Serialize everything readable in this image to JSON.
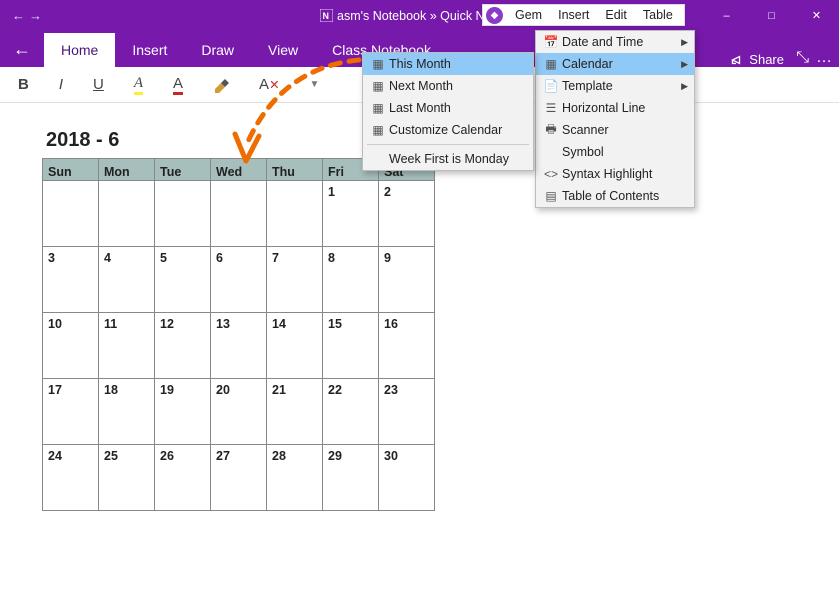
{
  "titlebar": {
    "app_title": "asm's Notebook » Quick N"
  },
  "tabs": {
    "home": "Home",
    "insert": "Insert",
    "draw": "Draw",
    "view": "View",
    "classnb": "Class Notebook"
  },
  "share_label": "Share",
  "format": {},
  "gem_menu": {
    "gem": "Gem",
    "insert": "Insert",
    "edit": "Edit",
    "table": "Table"
  },
  "insert_menu": {
    "datetime": "Date and Time",
    "calendar": "Calendar",
    "template": "Template",
    "hline": "Horizontal Line",
    "scanner": "Scanner",
    "symbol": "Symbol",
    "syntax": "Syntax Highlight",
    "toc": "Table of Contents"
  },
  "calendar_menu": {
    "this": "This Month",
    "next": "Next Month",
    "last": "Last Month",
    "custom": "Customize Calendar",
    "weekfirst": "Week First is Monday"
  },
  "calendar": {
    "title": "2018 - 6",
    "days": {
      "sun": "Sun",
      "mon": "Mon",
      "tue": "Tue",
      "wed": "Wed",
      "thu": "Thu",
      "fri": "Fri",
      "sat": "Sat"
    },
    "cells": {
      "r0": {
        "c0": "",
        "c1": "",
        "c2": "",
        "c3": "",
        "c4": "",
        "c5": "1",
        "c6": "2"
      },
      "r1": {
        "c0": "3",
        "c1": "4",
        "c2": "5",
        "c3": "6",
        "c4": "7",
        "c5": "8",
        "c6": "9"
      },
      "r2": {
        "c0": "10",
        "c1": "11",
        "c2": "12",
        "c3": "13",
        "c4": "14",
        "c5": "15",
        "c6": "16"
      },
      "r3": {
        "c0": "17",
        "c1": "18",
        "c2": "19",
        "c3": "20",
        "c4": "21",
        "c5": "22",
        "c6": "23"
      },
      "r4": {
        "c0": "24",
        "c1": "25",
        "c2": "26",
        "c3": "27",
        "c4": "28",
        "c5": "29",
        "c6": "30"
      }
    }
  }
}
